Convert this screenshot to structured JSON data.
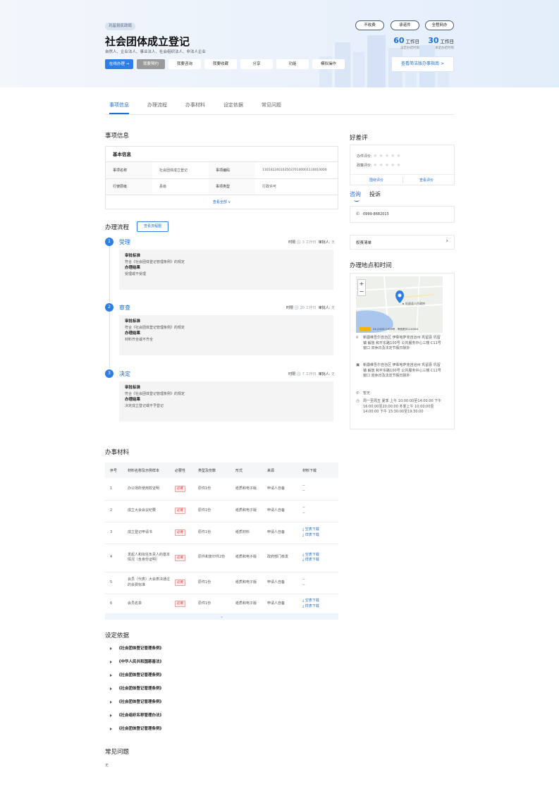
{
  "header": {
    "org_tag": "巩留县民政局",
    "title": "社会团体成立登记",
    "subjects": "自然人、企业法人、事业法人、社会组织法人、非法人企业",
    "buttons": [
      "在线办理 →",
      "我要预约",
      "我要咨询",
      "我要收藏",
      "分享",
      "功能",
      "模拟操作"
    ],
    "pills": [
      "不收费",
      "承诺件",
      "全程网办"
    ],
    "legal_days": {
      "num": "60",
      "unit": "工作日",
      "label": "法定办结时限"
    },
    "promise_days": {
      "num": "30",
      "unit": "工作日",
      "label": "承诺办结时限"
    },
    "guide_button": "查看简洁版办事指南 >"
  },
  "tabs": [
    "事项信息",
    "办理流程",
    "办事材料",
    "设定依据",
    "常见问题"
  ],
  "item_info": {
    "section_title": "事项信息",
    "box_title": "基本信息",
    "rows": [
      [
        "事项名称",
        "社会团体成立登记",
        "事项编码",
        "11654124010350370140001110010000"
      ],
      [
        "行使层级",
        "县级",
        "事项类型",
        "行政许可"
      ]
    ],
    "more": "查看全部 ∨"
  },
  "flow": {
    "section_title": "办理流程",
    "view_button": "查看流程图",
    "time_label": "时限",
    "approver_label": "审批人:",
    "std_label": "审批标准",
    "result_label": "办理结果",
    "steps": [
      {
        "no": "1",
        "name": "受理",
        "time": "3 工作日",
        "approver": "无",
        "std": "符合《社会团体登记管理条例》的规定",
        "result": "受理或不受理"
      },
      {
        "no": "2",
        "name": "审查",
        "time": "20 工作日",
        "approver": "无",
        "std": "符合《社会团体登记管理条例》的规定",
        "result": "材料齐全或不齐全"
      },
      {
        "no": "3",
        "name": "决定",
        "time": "7 工作日",
        "approver": "无",
        "std": "符合《社会团体登记管理条例》的规定",
        "result": "决定成立登记或不予登记"
      }
    ]
  },
  "materials": {
    "section_title": "办事材料",
    "headers": [
      "序号",
      "材料名称及示例样本",
      "必要性",
      "类型及份数",
      "形式",
      "来源",
      "材料下载"
    ],
    "required_label": "必要",
    "blank_dl": "空表下载",
    "sample_dl": "样表下载",
    "rows": [
      {
        "no": "1",
        "name": "办公场所使用权证明",
        "type": "原件1份",
        "form": "纸质和电子版",
        "src": "申请人自备",
        "dl": false
      },
      {
        "no": "2",
        "name": "成立大会会议纪要",
        "type": "原件1份",
        "form": "纸质和电子版",
        "src": "申请人自备",
        "dl": false
      },
      {
        "no": "3",
        "name": "成立登记申请书",
        "type": "原件1份",
        "form": "纸质材料",
        "src": "申请人自备",
        "dl": true
      },
      {
        "no": "4",
        "name": "发起人和拟任负责人的基本情况（含身份证明）",
        "type": "原件和复印件2份",
        "form": "纸质和电子版",
        "src": "政府部门核发",
        "dl": true
      },
      {
        "no": "5",
        "name": "会员（代表）大会表决通过的会费标准",
        "type": "原件1份",
        "form": "纸质和电子版",
        "src": "申请人自备",
        "dl": false
      },
      {
        "no": "6",
        "name": "会员名单",
        "type": "原件1份",
        "form": "纸质和电子版",
        "src": "申请人自备",
        "dl": true
      }
    ],
    "dash": "--",
    "expand": "⌄"
  },
  "basis": {
    "section_title": "设定依据",
    "items": [
      "《社会团体登记管理条例》",
      "《中华人民共和国慈善法》",
      "《社会团体登记管理条例》",
      "《社会团体登记管理条例》",
      "《社会团体登记管理条例》",
      "《社会组织名称管理办法》",
      "《社会团体登记管理条例》"
    ]
  },
  "faq": {
    "section_title": "常见问题",
    "content": "无"
  },
  "rating": {
    "section_title": "好差评",
    "rows": [
      "办件评价:",
      "政策评价:"
    ],
    "links": [
      "围绕评价",
      "查看评价"
    ]
  },
  "consult": {
    "tabs": [
      "咨询",
      "投诉"
    ],
    "phone": "0999-8682015"
  },
  "rights": {
    "label": "权责清单",
    "chevron": "›"
  },
  "location": {
    "section_title": "办理地点和时间",
    "map_pin_label": "巩留县人民政府",
    "map_zoom_in": "+",
    "map_zoom_out": "−",
    "map_copyright": "GS (2020) 1006号 - 甲测资字1110004",
    "entries": [
      "新疆维吾尔自治区 伊犁哈萨克自治州 巩留县 巩留镇 解放 和平东路100号 公共服务中心三楼 C11号窗口 双休日及法定节假日除外",
      "新疆维吾尔自治区 伊犁哈萨克自治州 巩留县 巩留镇 解放 和平东路100号 公共服务中心三楼 C11号窗口 双休日及法定节假日除外",
      "暂无",
      "周一至周五 夏季 上午 10:00:00至14:00:00 下午 16:00:00至20:00:00 冬季上午 10:00:00至14:00:00 下午 15:30:00至19:30:00"
    ]
  }
}
